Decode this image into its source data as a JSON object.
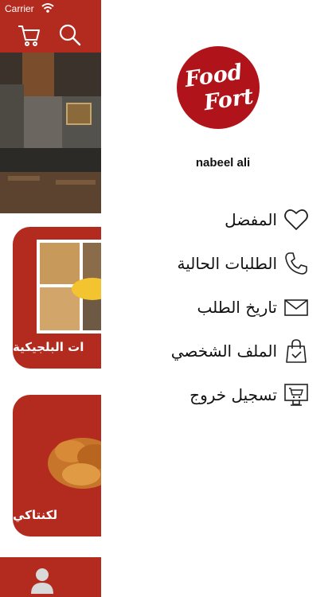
{
  "status_bar": {
    "carrier": "Carrier"
  },
  "topbar": {
    "cart_icon": "cart-icon",
    "search_icon": "search-icon"
  },
  "cards": [
    {
      "label": "ات البلجيكية"
    },
    {
      "label": "لكنتاكي"
    }
  ],
  "drawer": {
    "logo": {
      "line1": "Food",
      "line2": "Fort"
    },
    "username": "nabeel ali",
    "menu": [
      {
        "label": "المفضل",
        "icon": "heart-icon"
      },
      {
        "label": "الطلبات الحالية",
        "icon": "phone-icon"
      },
      {
        "label": "تاريخ الطلب",
        "icon": "envelope-icon"
      },
      {
        "label": "الملف الشخصي",
        "icon": "shopping-bag-icon"
      },
      {
        "label": "تسجيل خروج",
        "icon": "logout-screen-icon"
      }
    ]
  },
  "colors": {
    "brand": "#b32a1f",
    "logo": "#b1131a"
  }
}
